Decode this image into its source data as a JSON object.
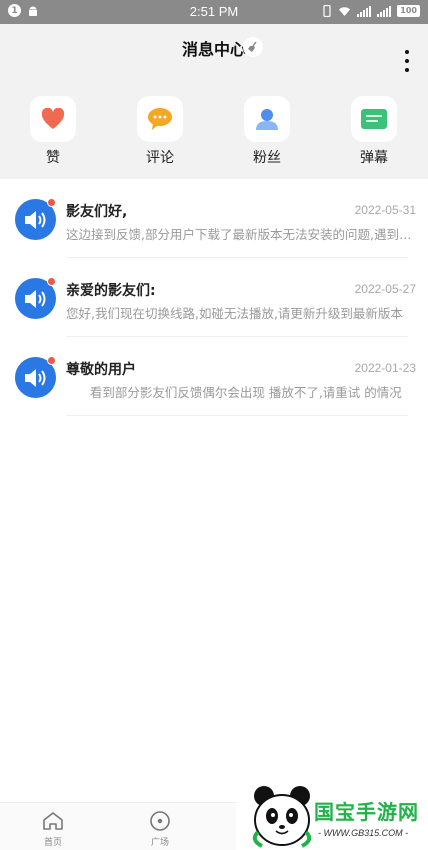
{
  "status_bar": {
    "notification_count": "1",
    "time": "2:51 PM",
    "battery": "100",
    "icons": [
      "notification-badge",
      "android-icon",
      "vibrate-icon",
      "wifi-icon",
      "signal-icon",
      "signal-icon",
      "battery-icon"
    ]
  },
  "header": {
    "title": "消息中心",
    "clean_icon": "broom-icon",
    "more_icon": "vertical-dots-icon"
  },
  "categories": [
    {
      "label": "赞",
      "icon": "heart-icon",
      "color": "#f06a52"
    },
    {
      "label": "评论",
      "icon": "chat-bubble-icon",
      "color": "#f5a623"
    },
    {
      "label": "粉丝",
      "icon": "user-icon",
      "color": "#4d8ef0"
    },
    {
      "label": "弹幕",
      "icon": "danmaku-icon",
      "color": "#3cc17a"
    }
  ],
  "messages": [
    {
      "title": "影友们好,",
      "date": "2022-05-31",
      "preview": "这边接到反馈,部分用户下载了最新版本无法安装的问题,遇到问题的用户请卸载后重新安装",
      "unread": true
    },
    {
      "title": "亲爱的影友们:",
      "date": "2022-05-27",
      "preview": "您好,我们现在切换线路,如碰无法播放,请更新升级到最新版本",
      "unread": true
    },
    {
      "title": "尊敬的用户",
      "date": "2022-01-23",
      "preview": "      看到部分影友们反馈偶尔会出现 播放不了,请重试 的情况",
      "unread": true
    }
  ],
  "tabbar": [
    {
      "label": "首页",
      "icon": "home-icon"
    },
    {
      "label": "广场",
      "icon": "plaza-icon"
    }
  ],
  "watermark": {
    "brand": "国宝手游网",
    "url": "- WWW.GB315.COM -"
  },
  "colors": {
    "accent_blue": "#2a78e4",
    "unread_dot": "#ee5a43",
    "header_bg": "#f2f2f2",
    "watermark_green": "#21b24a"
  }
}
